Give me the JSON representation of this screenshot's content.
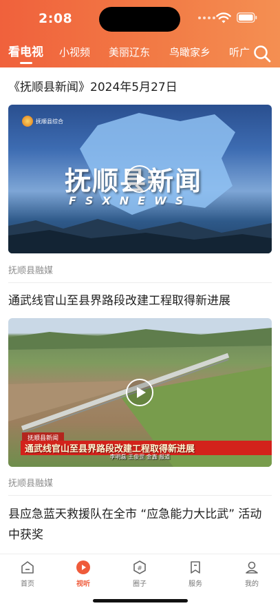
{
  "status_bar": {
    "time": "2:08"
  },
  "channel_tabs": [
    {
      "label": "看电视",
      "active": true
    },
    {
      "label": "小视频",
      "active": false
    },
    {
      "label": "美丽辽东",
      "active": false
    },
    {
      "label": "鸟瞰家乡",
      "active": false
    },
    {
      "label": "听广",
      "active": false
    }
  ],
  "feed": [
    {
      "title": "《抚顺县新闻》2024年5月27日",
      "source": "抚顺县融媒",
      "video": {
        "logo_text": "抚顺县综合",
        "headline": "抚顺县新闻",
        "subline": "FSXNEWS"
      }
    },
    {
      "title": "通武线官山至县界路段改建工程取得新进展",
      "source": "抚顺县融媒",
      "video": {
        "program_tag": "抚顺县新闻",
        "caption": "通武线官山至县界路段改建工程取得新进展",
        "credit": "李明磊 王俊罡 金鑫 报道"
      }
    },
    {
      "title": "县应急蓝天救援队在全市 “应急能力大比武” 活动中获奖"
    }
  ],
  "bottom_nav": [
    {
      "label": "首页",
      "icon": "home-icon",
      "active": false
    },
    {
      "label": "视听",
      "icon": "play-icon",
      "active": true
    },
    {
      "label": "圈子",
      "icon": "hashtag-icon",
      "active": false
    },
    {
      "label": "服务",
      "icon": "bookmark-icon",
      "active": false
    },
    {
      "label": "我的",
      "icon": "user-icon",
      "active": false
    }
  ],
  "colors": {
    "accent": "#ef5b3b",
    "header_start": "#f0613c",
    "header_end": "#f48f52"
  }
}
